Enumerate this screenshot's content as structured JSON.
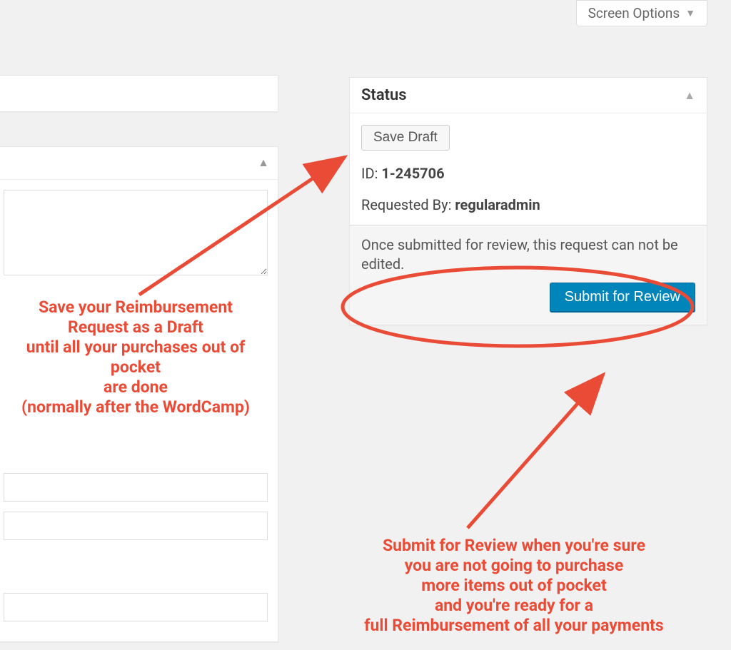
{
  "screen_options": {
    "label": "Screen Options"
  },
  "status_box": {
    "title": "Status",
    "save_draft_label": "Save Draft",
    "id_label": "ID:",
    "id_value": "1-245706",
    "requested_by_label": "Requested By:",
    "requested_by_value": "regularadmin",
    "notice": "Once submitted for review, this request can not be edited.",
    "submit_label": "Submit for Review"
  },
  "annotations": {
    "left": {
      "l1": "Save your Reimbursement",
      "l2": "Request as a Draft",
      "l3": "until all your purchases out of",
      "l4": "pocket",
      "l5": "are done",
      "l6": "(normally after the WordCamp)"
    },
    "right": {
      "l1": "Submit for Review when you're sure",
      "l2": "you are not going to purchase",
      "l3": "more items out of pocket",
      "l4": "and you're ready for a",
      "l5": "full Reimbursement of all your payments"
    }
  }
}
